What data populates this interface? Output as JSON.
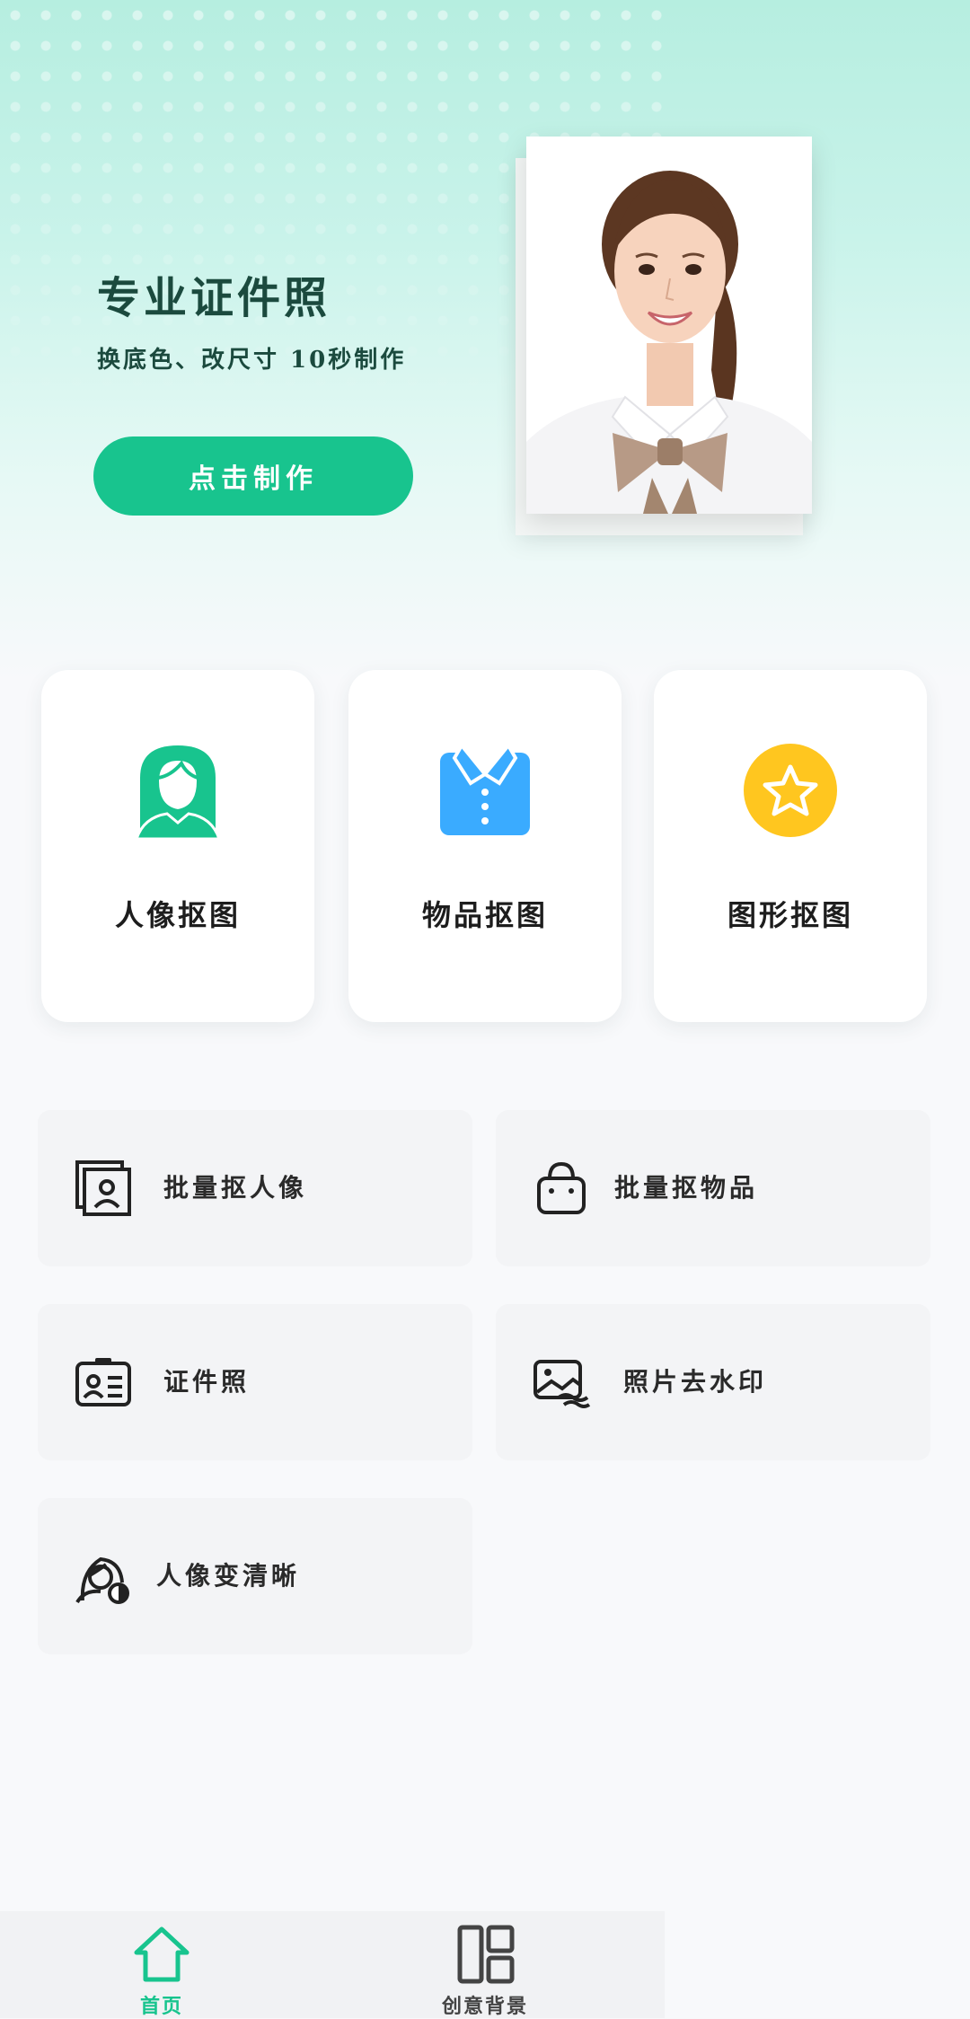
{
  "hero": {
    "title": "专业证件照",
    "subtitle": "换底色、改尺寸 10秒制作",
    "cta_label": "点击制作"
  },
  "cards": [
    {
      "label": "人像抠图",
      "icon": "person-silhouette-icon",
      "color": "#18c48e"
    },
    {
      "label": "物品抠图",
      "icon": "shirt-icon",
      "color": "#3aabff"
    },
    {
      "label": "图形抠图",
      "icon": "star-badge-icon",
      "color": "#ffc61f"
    }
  ],
  "tools": [
    {
      "label": "批量抠人像",
      "icon": "portrait-frames-icon"
    },
    {
      "label": "批量抠物品",
      "icon": "shopping-bag-icon"
    },
    {
      "label": "证件照",
      "icon": "id-card-icon"
    },
    {
      "label": "照片去水印",
      "icon": "image-wave-icon"
    },
    {
      "label": "人像变清晰",
      "icon": "face-enhance-icon"
    }
  ],
  "tabbar": {
    "home_label": "首页",
    "creative_label": "创意背景",
    "active_color": "#18c48e",
    "inactive_color": "#444444"
  }
}
